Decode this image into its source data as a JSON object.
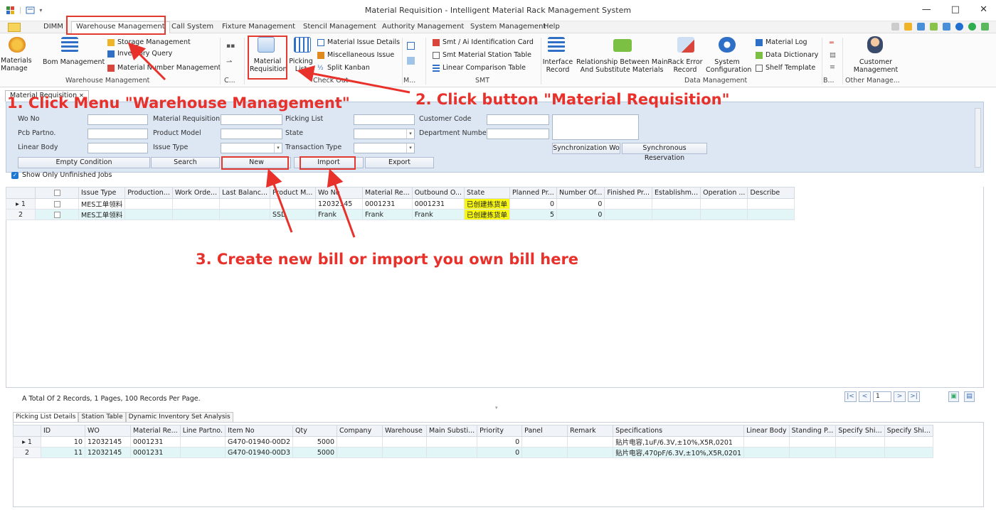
{
  "window": {
    "title": "Material Requisition - Intelligent Material Rack Management System",
    "controls": [
      "—",
      "□",
      "✕"
    ]
  },
  "menubar": {
    "items": [
      "DIMM",
      "Warehouse Management",
      "Call System",
      "Fixture Management",
      "Stencil Management",
      "Authority Management",
      "System Management",
      "Help"
    ],
    "active": "Warehouse Management"
  },
  "ribbon": {
    "materials_manage": [
      "Materials",
      "Manage"
    ],
    "bom_management": "Bom Management",
    "storage_management": "Storage Management",
    "inventory_query": "Inventory Query",
    "material_number_management": "Material Number Management",
    "group_warehouse": "Warehouse Management",
    "group_c": "C...",
    "material_requisition": [
      "Material",
      "Requisition"
    ],
    "picking_list": [
      "Picking",
      "List"
    ],
    "material_issue_details": "Material Issue Details",
    "miscellaneous_issue": "Miscellaneous Issue",
    "split_kanban": "Split Kanban",
    "group_checkout": "Check Out",
    "group_m": "M...",
    "smt_ai_card": "Smt / Ai Identification Card",
    "smt_station_table": "Smt Material Station Table",
    "linear_comparison": "Linear Comparison Table",
    "group_smt": "SMT",
    "interface_record": [
      "Interface",
      "Record"
    ],
    "relationship": [
      "Relationship Between Main",
      "And Substitute Materials"
    ],
    "rack_error_record": [
      "Rack Error",
      "Record"
    ],
    "system_configuration": [
      "System",
      "Configuration"
    ],
    "material_log": "Material Log",
    "data_dictionary": "Data Dictionary",
    "shelf_template": "Shelf Template",
    "group_data": "Data Management",
    "group_b": "B...",
    "customer_management": [
      "Customer",
      "Management"
    ],
    "group_other": "Other Manage..."
  },
  "doc_tab": {
    "label": "Material Requisition",
    "close": "✕"
  },
  "filter": {
    "labels": {
      "wo_no": "Wo No",
      "pcb_partno": "Pcb Partno.",
      "linear_body": "Linear Body",
      "material_requisition": "Material Requisition",
      "product_model": "Product Model",
      "issue_type": "Issue Type",
      "picking_list": "Picking List",
      "state": "State",
      "transaction_type": "Transaction Type",
      "customer_code": "Customer Code",
      "department_number": "Department Number"
    },
    "buttons": {
      "empty": "Empty Condition",
      "search": "Search",
      "new": "New",
      "import": "Import",
      "export": "Export",
      "sync_wo": "Synchronization Wo",
      "sync_reservation": "Synchronous Reservation"
    }
  },
  "show_unfinished": "Show Only Unfinished Jobs",
  "grid1": {
    "headers": [
      "",
      "",
      "Issue Type",
      "Production...",
      "Work Orde...",
      "Last Balanc...",
      "Product M...",
      "Wo No",
      "Material Re...",
      "Outbound O...",
      "State",
      "Planned Pr...",
      "Number Of...",
      "Finished Pr...",
      "Establishm...",
      "Operation ...",
      "Describe"
    ],
    "rows": [
      [
        "▸ 1",
        "",
        "MES工单领料",
        "",
        "",
        "",
        "",
        "12032145",
        "0001231",
        "0001231",
        "已创建拣货单",
        "0",
        "0",
        "",
        "",
        "",
        ""
      ],
      [
        "2",
        "",
        "MES工单领料",
        "",
        "",
        "",
        "SSD",
        "Frank",
        "Frank",
        "Frank",
        "已创建拣货单",
        "5",
        "0",
        "",
        "",
        "",
        ""
      ]
    ]
  },
  "status": {
    "text": "A Total Of 2 Records, 1 Pages, 100 Records Per Page.",
    "page": "1",
    "pager": [
      "|<",
      "<",
      ">",
      ">|"
    ]
  },
  "bottom_tabs": [
    "Picking List Details",
    "Station Table",
    "Dynamic Inventory Set Analysis"
  ],
  "grid2": {
    "headers": [
      "",
      "ID",
      "WO",
      "Material Re...",
      "Line Partno.",
      "Item No",
      "Qty",
      "Company",
      "Warehouse",
      "Main Substi...",
      "Priority",
      "Panel",
      "Remark",
      "Specifications",
      "Linear Body",
      "Standing P...",
      "Specify Shi...",
      "Specify Shi..."
    ],
    "rows": [
      [
        "▸ 1",
        "10",
        "12032145",
        "0001231",
        "",
        "G470-01940-00D2",
        "5000",
        "",
        "",
        "",
        "0",
        "",
        "",
        "贴片电容,1uF/6.3V,±10%,X5R,0201",
        "",
        "",
        "",
        ""
      ],
      [
        "2",
        "11",
        "12032145",
        "0001231",
        "",
        "G470-01940-00D3",
        "5000",
        "",
        "",
        "",
        "0",
        "",
        "",
        "贴片电容,470pF/6.3V,±10%,X5R,0201",
        "",
        "",
        "",
        ""
      ]
    ]
  },
  "annotations": {
    "step1": "1. Click Menu \"Warehouse Management\"",
    "step2": "2. Click button \"Material Requisition\"",
    "step3": "3. Create new bill or import you own bill here"
  },
  "colors": {
    "accent_red": "#e8312b",
    "state_yellow": "#f7f711",
    "filter_bg": "#dde6f3",
    "alt_row": "#e2f6f7"
  }
}
